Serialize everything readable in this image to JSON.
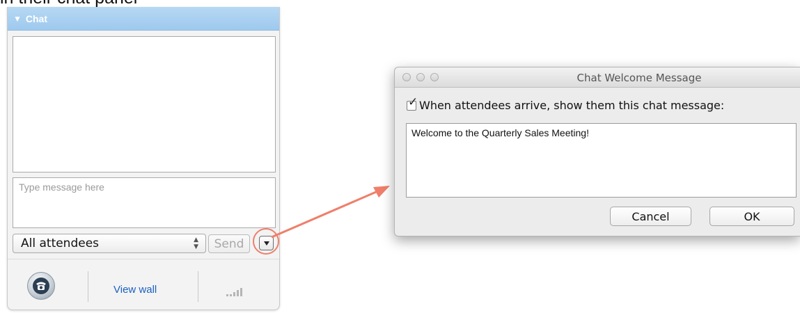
{
  "caption": {
    "text": "in their chat panel"
  },
  "chat_panel": {
    "header_title": "Chat",
    "input_placeholder": "Type message here",
    "recipient_selected": "All attendees",
    "send_label": "Send",
    "view_wall_label": "View wall"
  },
  "dialog": {
    "title": "Chat Welcome Message",
    "checkbox_label": "When attendees arrive, show them this chat message:",
    "checkbox_checked": true,
    "message": "Welcome to the Quarterly Sales Meeting!",
    "cancel_label": "Cancel",
    "ok_label": "OK"
  },
  "colors": {
    "chat_header": "#9ec9ee",
    "highlight_ring": "#ef7f6b",
    "link": "#1a5fc2"
  },
  "icons": {
    "header_toggle": "triangle-down-icon",
    "options": "chevron-down-icon",
    "phone": "phone-icon",
    "signal": "signal-strength-icon"
  }
}
